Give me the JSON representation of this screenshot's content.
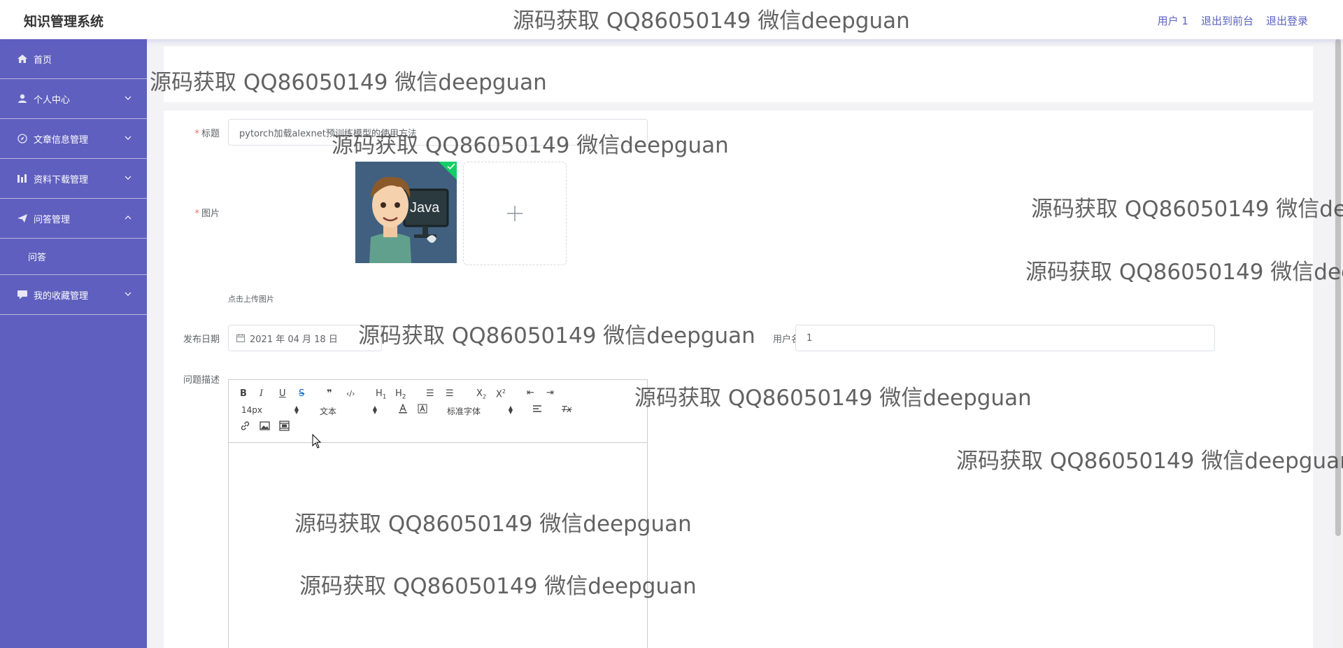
{
  "header": {
    "brand": "知识管理系统",
    "user": "用户 1",
    "back_to_front": "退出到前台",
    "logout": "退出登录"
  },
  "sidebar": {
    "items": [
      {
        "label": "首页",
        "icon": "home-icon"
      },
      {
        "label": "个人中心",
        "icon": "user-icon"
      },
      {
        "label": "文章信息管理",
        "icon": "compass-icon"
      },
      {
        "label": "资料下载管理",
        "icon": "bar-chart-icon"
      },
      {
        "label": "问答管理",
        "icon": "send-icon"
      },
      {
        "label": "我的收藏管理",
        "icon": "chat-icon"
      }
    ],
    "submenu_qa": "问答"
  },
  "form": {
    "title_label": "标题",
    "title_value": "pytorch加载alexnet预训练模型的使用方法",
    "image_label": "图片",
    "upload_tip": "点击上传图片",
    "date_label": "发布日期",
    "date_value": "2021 年 04 月 18 日",
    "username_label": "用户名",
    "username_value": "1",
    "desc_label": "问题描述",
    "thumb_text": "Java"
  },
  "editor": {
    "bold": "B",
    "italic": "I",
    "underline": "U",
    "strike": "S",
    "quote": "❞",
    "code": "‹/›",
    "h1": "H",
    "h1_sub": "1",
    "h2": "H",
    "h2_sub": "2",
    "ordered_list": "☰",
    "bullet_list": "☰",
    "subscript": "X",
    "subscript_mark": "2",
    "superscript": "X",
    "superscript_mark": "2",
    "outdent": "⇤",
    "indent": "⇥",
    "size_value": "14px",
    "header_value": "文本",
    "font_value": "标准字体",
    "clean": "Tx"
  },
  "watermark_text": "源码获取 QQ86050149 微信deepguan",
  "colors": {
    "sidebar": "#5f5fbf",
    "accent": "#5b63c2",
    "required": "#f56c6c",
    "success": "#13ce66"
  }
}
